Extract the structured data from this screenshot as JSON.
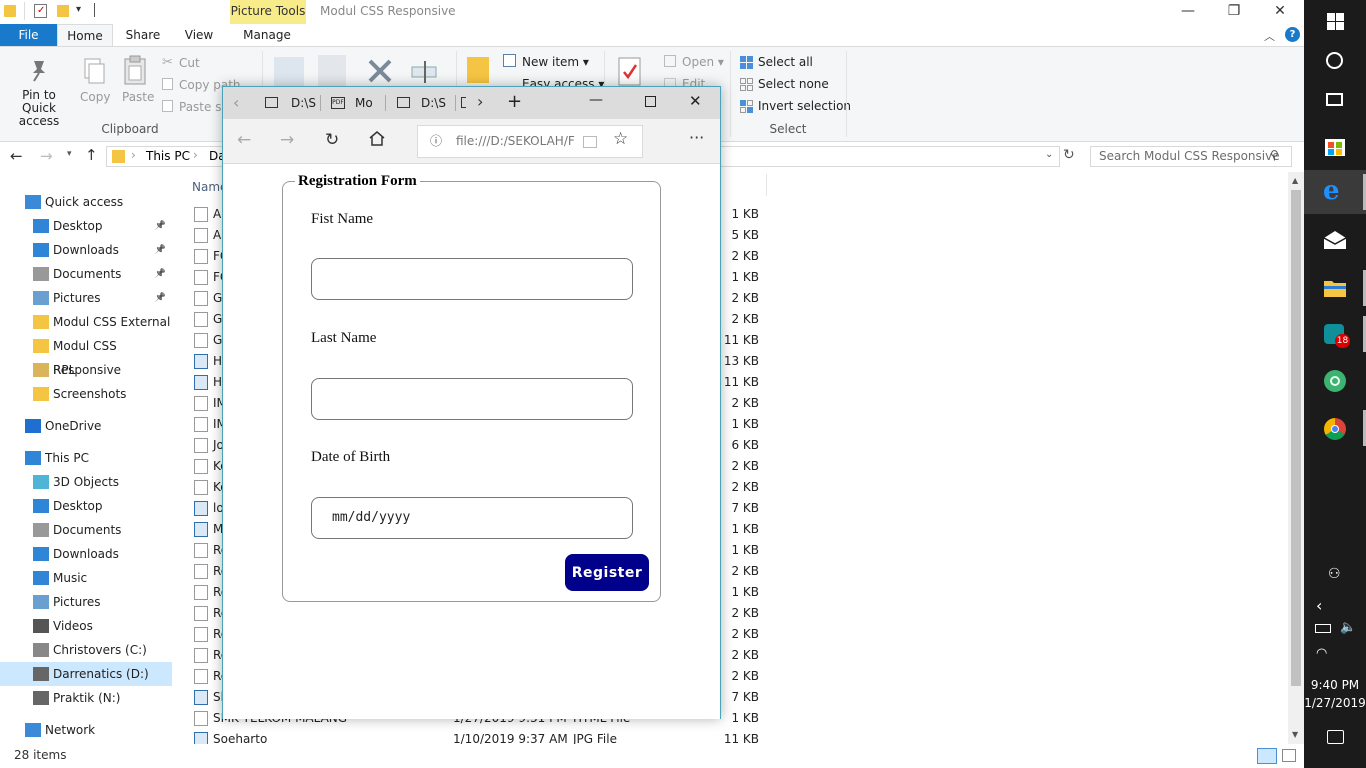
{
  "explorer": {
    "title": "Modul CSS Responsive",
    "context_tab": "Picture Tools",
    "tabs": [
      "File",
      "Home",
      "Share",
      "View",
      "Manage"
    ],
    "ribbon": {
      "pin": "Pin to Quick access",
      "copy": "Copy",
      "paste": "Paste",
      "cut": "Cut",
      "copy_path": "Copy path",
      "paste_shortcut": "Paste sho",
      "clipboard_group": "Clipboard",
      "new_item": "New item",
      "easy_access": "Easy access",
      "open": "Open",
      "edit": "Edit",
      "select_all": "Select all",
      "select_none": "Select none",
      "invert_selection": "Invert selection",
      "select_group": "Select"
    },
    "address": {
      "root": "This PC",
      "partial": "Da"
    },
    "search_placeholder": "Search Modul CSS Responsive",
    "column_name": "Name",
    "nav": {
      "quick_access": "Quick access",
      "items": [
        {
          "label": "Desktop",
          "pinned": true
        },
        {
          "label": "Downloads",
          "pinned": true
        },
        {
          "label": "Documents",
          "pinned": true
        },
        {
          "label": "Pictures",
          "pinned": true
        },
        {
          "label": "Modul CSS External"
        },
        {
          "label": "Modul CSS Responsive"
        },
        {
          "label": "RPL"
        },
        {
          "label": "Screenshots"
        }
      ],
      "onedrive": "OneDrive",
      "this_pc": "This PC",
      "pc_items": [
        "3D Objects",
        "Desktop",
        "Documents",
        "Downloads",
        "Music",
        "Pictures",
        "Videos",
        "Christovers (C:)",
        "Darrenatics (D:)",
        "Praktik (N:)"
      ],
      "network": "Network"
    },
    "files": [
      {
        "name": "Al",
        "size": "1 KB"
      },
      {
        "name": "Al",
        "size": "5 KB"
      },
      {
        "name": "FC",
        "size": "2 KB"
      },
      {
        "name": "FC",
        "size": "1 KB"
      },
      {
        "name": "Gl",
        "size": "2 KB"
      },
      {
        "name": "Gl",
        "size": "2 KB"
      },
      {
        "name": "Gu",
        "size": "11 KB"
      },
      {
        "name": "H",
        "size": "13 KB"
      },
      {
        "name": "H",
        "size": "11 KB"
      },
      {
        "name": "IM",
        "size": "2 KB"
      },
      {
        "name": "IM",
        "size": "1 KB"
      },
      {
        "name": "Jo",
        "size": "6 KB"
      },
      {
        "name": "Ko",
        "size": "2 KB"
      },
      {
        "name": "Ko",
        "size": "2 KB"
      },
      {
        "name": "lo",
        "size": "7 KB"
      },
      {
        "name": "M",
        "size": "1 KB"
      },
      {
        "name": "Re",
        "size": "1 KB"
      },
      {
        "name": "Re",
        "size": "2 KB"
      },
      {
        "name": "Re",
        "size": "1 KB"
      },
      {
        "name": "Re",
        "size": "2 KB"
      },
      {
        "name": "Re",
        "size": "2 KB"
      },
      {
        "name": "Re",
        "size": "2 KB"
      },
      {
        "name": "Re",
        "size": "2 KB"
      },
      {
        "name": "Sb",
        "size": "7 KB"
      },
      {
        "name": "SMK TELKOM MALANG",
        "date": "1/27/2019 9:31 PM",
        "type": "HTML File",
        "size": "1 KB"
      },
      {
        "name": "Soeharto",
        "date": "1/10/2019 9:37 AM",
        "type": "JPG File",
        "size": "11 KB"
      }
    ],
    "status": "28 items"
  },
  "taskbar": {
    "time": "9:40 PM",
    "date": "1/27/2019",
    "badge": "18"
  },
  "edge": {
    "tabs": [
      "D:\\S",
      "Mo",
      "D:\\S"
    ],
    "url": "file:///D:/SEKOLAH/F",
    "more": "···"
  },
  "form": {
    "legend": "Registration Form",
    "first_name_label": "Fist Name",
    "last_name_label": "Last Name",
    "dob_label": "Date of Birth",
    "dob_placeholder": "mm/dd/yyyy",
    "submit": "Register"
  }
}
